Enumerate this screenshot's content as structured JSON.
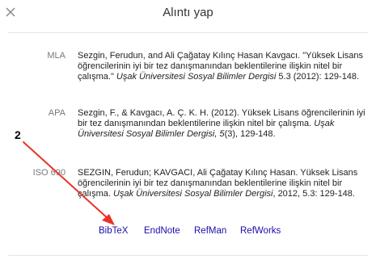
{
  "dialog": {
    "title": "Alıntı yap"
  },
  "citations": [
    {
      "label": "MLA",
      "text_before": "Sezgin, Ferudun, and Ali Çağatay Kılınç Hasan Kavgacı. \"Yüksek Lisans öğrencilerinin iyi bir tez danışmanından beklentilerine ilişkin nitel bir çalışma.\" ",
      "italic": "Uşak Üniversitesi Sosyal Bilimler Dergisi",
      "text_after": " 5.3 (2012): 129-148."
    },
    {
      "label": "APA",
      "text_before": "Sezgin, F., & Kavgacı, A. Ç. K. H. (2012). Yüksek Lisans öğrencilerinin iyi bir tez danışmanından beklentilerine ilişkin nitel bir çalışma. ",
      "italic": "Uşak Üniversitesi Sosyal Bilimler Dergisi, 5",
      "text_after": "(3), 129-148."
    },
    {
      "label": "ISO 690",
      "text_before": "SEZGIN, Ferudun; KAVGACI, Ali Çağatay Kılınç Hasan. Yüksek Lisans öğrencilerinin iyi bir tez danışmanından beklentilerine ilişkin nitel bir çalışma. ",
      "italic": "Uşak Üniversitesi Sosyal Bilimler Dergisi",
      "text_after": ", 2012, 5.3: 129-148."
    }
  ],
  "export_links": [
    {
      "label": "BibTeX"
    },
    {
      "label": "EndNote"
    },
    {
      "label": "RefMan"
    },
    {
      "label": "RefWorks"
    }
  ],
  "annotation": {
    "number": "2",
    "color": "#e8332a"
  },
  "colors": {
    "link": "#1a0dab",
    "label": "#777777",
    "text": "#222222"
  }
}
